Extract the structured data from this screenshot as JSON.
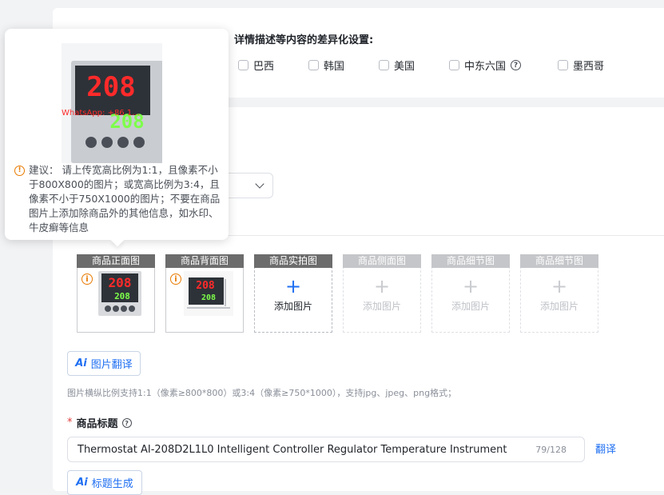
{
  "locale_settings": {
    "heading": "详情描述等内容的差异化设置:",
    "countries": [
      {
        "label": "巴西",
        "checked": false
      },
      {
        "label": "韩国",
        "checked": false
      },
      {
        "label": "美国",
        "checked": false
      },
      {
        "label": "中东六国",
        "checked": false,
        "help_icon": "question-circle-icon"
      },
      {
        "label": "墨西哥",
        "checked": false
      }
    ]
  },
  "tooltip": {
    "icon": "warning-circle-icon",
    "text": "建议： 请上传宽高比例为1:1，且像素不小于800X800的图片；或宽高比例为3:4，且像素不小于750X1000的图片；不要在商品图片上添加除商品外的其他信息，如水印、牛皮癣等信息",
    "image_watermark": "WhatsApp: +86 1..."
  },
  "images": {
    "slots": [
      {
        "label": "商品正面图",
        "state": "filled",
        "warning": true
      },
      {
        "label": "商品背面图",
        "state": "filled",
        "warning": true
      },
      {
        "label": "商品实拍图",
        "state": "empty",
        "add_text": "添加图片"
      },
      {
        "label": "商品侧面图",
        "state": "disabled",
        "add_text": "添加图片"
      },
      {
        "label": "商品细节图",
        "state": "disabled",
        "add_text": "添加图片"
      },
      {
        "label": "商品细节图",
        "state": "disabled",
        "add_text": "添加图片"
      }
    ],
    "translate_button": {
      "icon_text": "Ai",
      "label": "图片翻译"
    },
    "hint": "图片横纵比例支持1:1（像素≥800*800）或3:4（像素≥750*1000），支持jpg、jpeg、png格式；"
  },
  "thumbnail": {
    "display_top": "208",
    "display_bottom": "208"
  },
  "title_field": {
    "required_mark": "*",
    "label": "商品标题",
    "value": "Thermostat AI-208D2L1L0 Intelligent Controller Regulator Temperature Instrument",
    "count": "79/128",
    "translate_label": "翻译",
    "generate_button": {
      "icon_text": "Ai",
      "label": "标题生成"
    }
  },
  "colors": {
    "accent": "#1f6ff2",
    "warning": "#e87a00",
    "required": "#e13a3a",
    "led_red": "#ff2a2a",
    "led_green": "#7dff4a"
  }
}
